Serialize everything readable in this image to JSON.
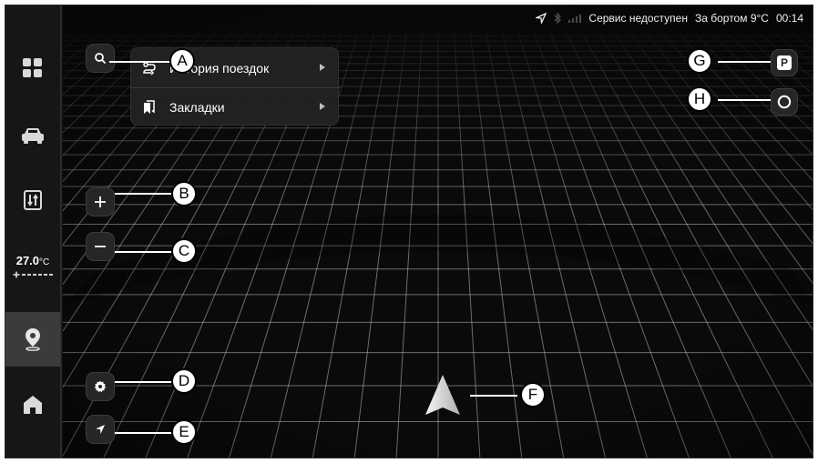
{
  "status_bar": {
    "icons": [
      "navigation-arrow-icon",
      "bluetooth-icon",
      "signal-icon"
    ],
    "service_text": "Сервис недоступен",
    "outside_temp": "За бортом 9°C",
    "time": "00:14"
  },
  "sidebar": {
    "items": [
      {
        "name": "apps",
        "icon": "apps-grid-icon"
      },
      {
        "name": "car",
        "icon": "car-icon"
      },
      {
        "name": "transfer",
        "icon": "transfer-icon"
      },
      {
        "name": "navigation",
        "icon": "location-pin-icon",
        "active": true
      },
      {
        "name": "home",
        "icon": "home-icon"
      }
    ],
    "climate": {
      "temperature": "27.0",
      "unit": "°C",
      "fan_icon": "fan-icon"
    }
  },
  "menu": {
    "items": [
      {
        "label": "История поездок",
        "icon": "route-history-icon"
      },
      {
        "label": "Закладки",
        "icon": "bookmarks-icon"
      }
    ]
  },
  "map_buttons": {
    "search": "search-icon",
    "zoom_in": "plus-icon",
    "zoom_out": "minus-icon",
    "settings": "gear-icon",
    "locate": "location-arrow-icon",
    "parking": "P",
    "layers": "circle-icon"
  },
  "callouts": [
    "A",
    "B",
    "C",
    "D",
    "E",
    "F",
    "G",
    "H"
  ],
  "colors": {
    "background": "#0a0a0a",
    "grid": "#bdbdbd",
    "active_sidebar": "#3b3b3b",
    "callout": "#ffffff"
  }
}
